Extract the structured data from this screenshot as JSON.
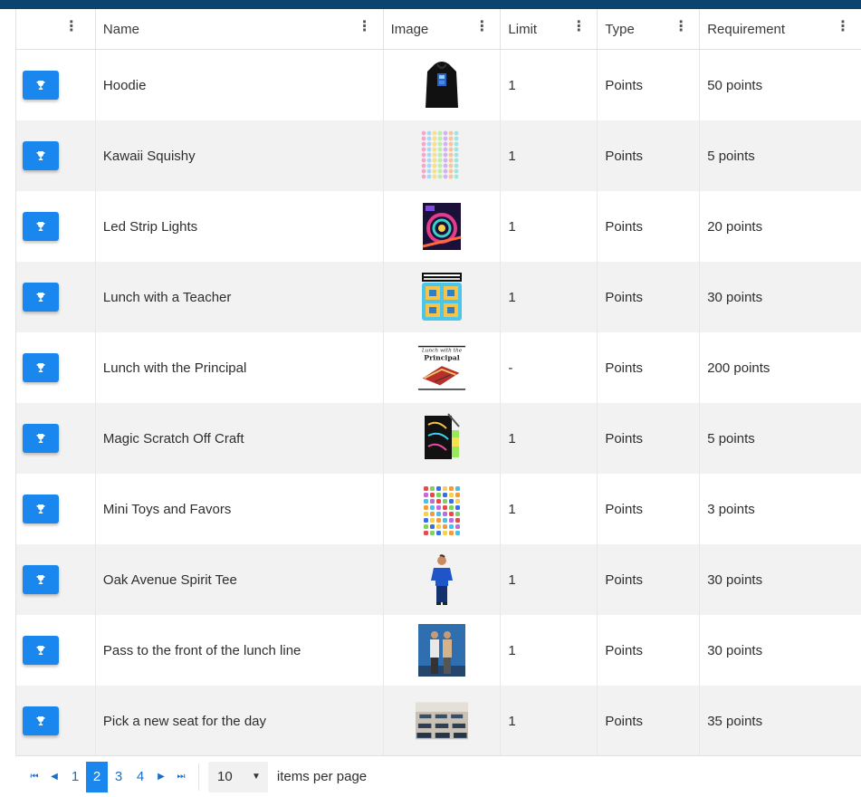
{
  "columns": {
    "name": "Name",
    "image": "Image",
    "limit": "Limit",
    "type": "Type",
    "requirement": "Requirement"
  },
  "menu_glyph": "⋮",
  "rows": [
    {
      "name": "Hoodie",
      "limit": "1",
      "type": "Points",
      "requirement": "50 points",
      "image": "hoodie-image"
    },
    {
      "name": "Kawaii Squishy",
      "limit": "1",
      "type": "Points",
      "requirement": "5 points",
      "image": "squishy-image"
    },
    {
      "name": "Led Strip Lights",
      "limit": "1",
      "type": "Points",
      "requirement": "20 points",
      "image": "led-lights-image"
    },
    {
      "name": "Lunch with a Teacher",
      "limit": "1",
      "type": "Points",
      "requirement": "30 points",
      "image": "lunch-teacher-image"
    },
    {
      "name": "Lunch with the Principal",
      "limit": "-",
      "type": "Points",
      "requirement": "200 points",
      "image": "lunch-principal-image"
    },
    {
      "name": "Magic Scratch Off Craft",
      "limit": "1",
      "type": "Points",
      "requirement": "5 points",
      "image": "scratch-craft-image"
    },
    {
      "name": "Mini Toys and Favors",
      "limit": "1",
      "type": "Points",
      "requirement": "3 points",
      "image": "mini-toys-image"
    },
    {
      "name": "Oak Avenue Spirit Tee",
      "limit": "1",
      "type": "Points",
      "requirement": "30 points",
      "image": "spirit-tee-image"
    },
    {
      "name": "Pass to the front of the lunch line",
      "limit": "1",
      "type": "Points",
      "requirement": "30 points",
      "image": "lunch-line-image"
    },
    {
      "name": "Pick a new seat for the day",
      "limit": "1",
      "type": "Points",
      "requirement": "35 points",
      "image": "classroom-seat-image"
    }
  ],
  "pager": {
    "first_glyph": "⏮",
    "prev_glyph": "◀",
    "next_glyph": "▶",
    "last_glyph": "⏭",
    "pages": [
      "1",
      "2",
      "3",
      "4"
    ],
    "current_page": "2",
    "per_page_value": "10",
    "per_page_caret": "▼",
    "per_page_label": "items per page"
  },
  "colors": {
    "top_bar": "#0c4470",
    "accent": "#1a87ee",
    "row_alt": "#f2f2f2"
  }
}
